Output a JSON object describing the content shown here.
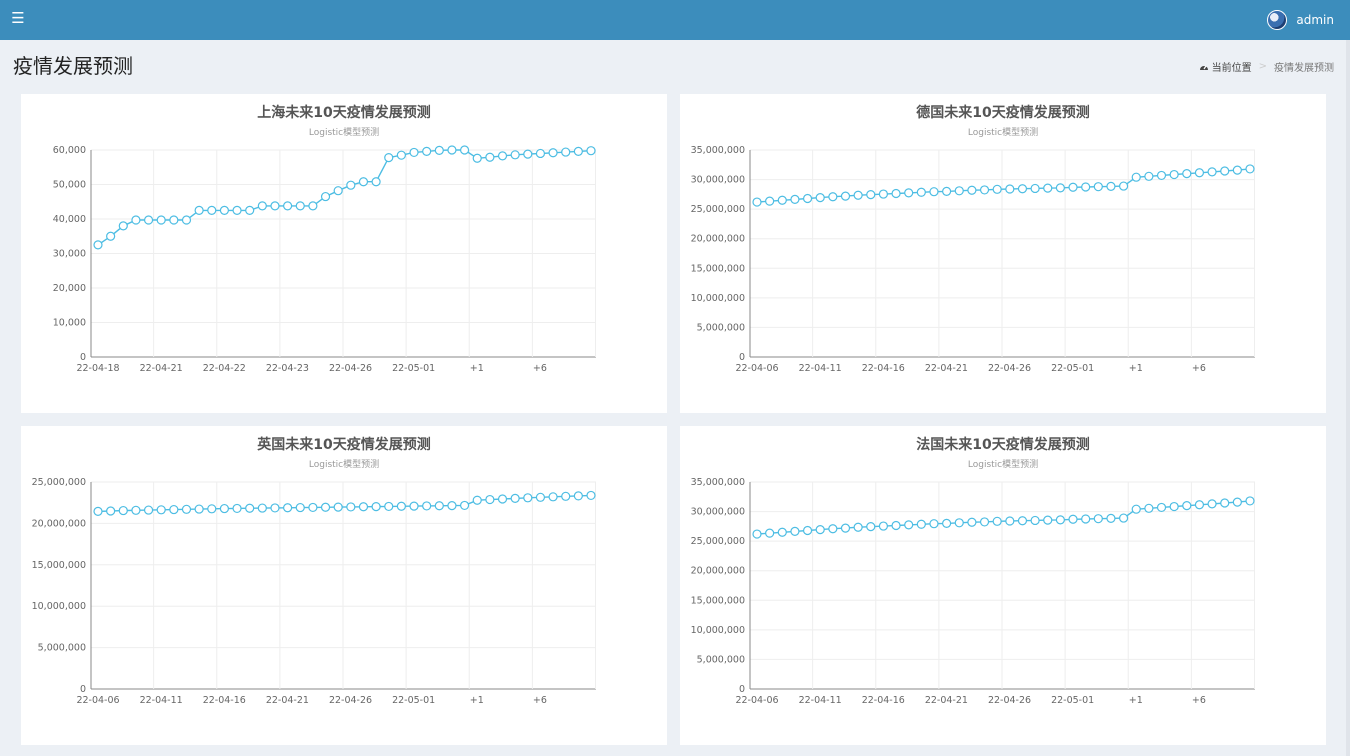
{
  "header": {
    "menu_icon": "hamburger-icon",
    "user_name": "admin",
    "brand_color": "#3c8dbc"
  },
  "page": {
    "title": "疫情发展预测",
    "breadcrumb_home": "当前位置",
    "breadcrumb_current": "疫情发展预测",
    "breadcrumb_separator": ">"
  },
  "chart_data": [
    {
      "type": "line",
      "title": "上海未来10天疫情发展预测",
      "subtitle": "Logistic模型预测",
      "color": "#4dbde3",
      "ylim": [
        0,
        60000
      ],
      "yticks": [
        0,
        10000,
        20000,
        30000,
        40000,
        50000,
        60000
      ],
      "xtick_labels": [
        "22-04-18",
        "22-04-21",
        "22-04-22",
        "22-04-23",
        "22-04-26",
        "22-05-01",
        "+1",
        "+6"
      ],
      "values": [
        32500,
        35000,
        38000,
        39700,
        39700,
        39700,
        39700,
        39700,
        42500,
        42500,
        42500,
        42500,
        42500,
        43800,
        43800,
        43800,
        43800,
        43800,
        46500,
        48200,
        49800,
        50800,
        50800,
        57800,
        58500,
        59300,
        59600,
        59900,
        60000,
        60000,
        57600,
        57900,
        58300,
        58600,
        58800,
        59000,
        59200,
        59400,
        59600,
        59800
      ]
    },
    {
      "type": "line",
      "title": "德国未来10天疫情发展预测",
      "subtitle": "Logistic模型预测",
      "color": "#4dbde3",
      "ylim": [
        0,
        35000000
      ],
      "yticks": [
        0,
        5000000,
        10000000,
        15000000,
        20000000,
        25000000,
        30000000,
        35000000
      ],
      "xtick_labels": [
        "22-04-06",
        "22-04-11",
        "22-04-16",
        "22-04-21",
        "22-04-26",
        "22-05-01",
        "+1",
        "+6"
      ],
      "values": [
        26200000,
        26350000,
        26500000,
        26650000,
        26800000,
        26950000,
        27100000,
        27200000,
        27350000,
        27450000,
        27550000,
        27650000,
        27750000,
        27850000,
        27950000,
        28000000,
        28100000,
        28200000,
        28250000,
        28350000,
        28400000,
        28450000,
        28500000,
        28550000,
        28600000,
        28700000,
        28750000,
        28800000,
        28850000,
        28900000,
        30400000,
        30550000,
        30700000,
        30850000,
        31000000,
        31150000,
        31300000,
        31450000,
        31600000,
        31800000
      ]
    },
    {
      "type": "line",
      "title": "英国未来10天疫情发展预测",
      "subtitle": "Logistic模型预测",
      "color": "#4dbde3",
      "ylim": [
        0,
        25000000
      ],
      "yticks": [
        0,
        5000000,
        10000000,
        15000000,
        20000000,
        25000000
      ],
      "xtick_labels": [
        "22-04-06",
        "22-04-11",
        "22-04-16",
        "22-04-21",
        "22-04-26",
        "22-05-01",
        "+1",
        "+6"
      ],
      "values": [
        21450000,
        21500000,
        21550000,
        21580000,
        21610000,
        21640000,
        21670000,
        21700000,
        21730000,
        21760000,
        21790000,
        21810000,
        21830000,
        21850000,
        21870000,
        21890000,
        21910000,
        21930000,
        21950000,
        21970000,
        21990000,
        22010000,
        22030000,
        22050000,
        22070000,
        22090000,
        22110000,
        22130000,
        22150000,
        22170000,
        22800000,
        22880000,
        22950000,
        23020000,
        23090000,
        23150000,
        23210000,
        23270000,
        23320000,
        23380000
      ]
    },
    {
      "type": "line",
      "title": "法国未来10天疫情发展预测",
      "subtitle": "Logistic模型预测",
      "color": "#4dbde3",
      "ylim": [
        0,
        35000000
      ],
      "yticks": [
        0,
        5000000,
        10000000,
        15000000,
        20000000,
        25000000,
        30000000,
        35000000
      ],
      "xtick_labels": [
        "22-04-06",
        "22-04-11",
        "22-04-16",
        "22-04-21",
        "22-04-26",
        "22-05-01",
        "+1",
        "+6"
      ],
      "values": [
        26200000,
        26350000,
        26500000,
        26650000,
        26800000,
        26950000,
        27100000,
        27200000,
        27350000,
        27450000,
        27550000,
        27650000,
        27750000,
        27850000,
        27950000,
        28000000,
        28100000,
        28200000,
        28250000,
        28350000,
        28400000,
        28450000,
        28500000,
        28550000,
        28600000,
        28700000,
        28750000,
        28800000,
        28850000,
        28900000,
        30400000,
        30550000,
        30700000,
        30850000,
        31000000,
        31150000,
        31300000,
        31450000,
        31600000,
        31800000
      ]
    }
  ]
}
